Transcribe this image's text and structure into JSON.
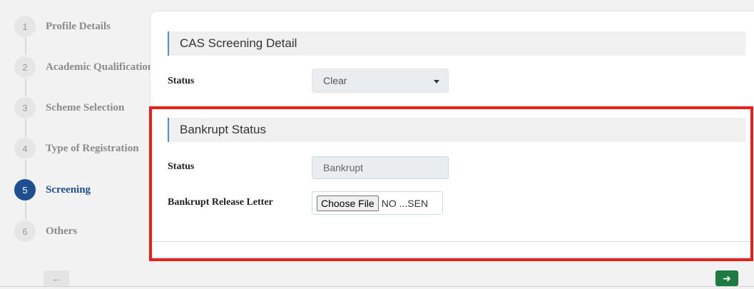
{
  "stepper": {
    "steps": [
      {
        "number": "1",
        "label": "Profile Details"
      },
      {
        "number": "2",
        "label": "Academic Qualifications"
      },
      {
        "number": "3",
        "label": "Scheme Selection"
      },
      {
        "number": "4",
        "label": "Type of Registration"
      },
      {
        "number": "5",
        "label": "Screening"
      },
      {
        "number": "6",
        "label": "Others"
      }
    ],
    "active_step": "5"
  },
  "cas_section": {
    "title": "CAS Screening Detail",
    "status_label": "Status",
    "status_value": "Clear"
  },
  "bankrupt_section": {
    "title": "Bankrupt Status",
    "status_label": "Status",
    "status_value": "Bankrupt",
    "letter_label": "Bankrupt Release Letter",
    "choose_file_label": "Choose File",
    "file_text": "NO ...SEN"
  },
  "navigation": {
    "prev_icon": "arrow-left-icon",
    "next_icon": "arrow-right-icon"
  },
  "colors": {
    "active_step": "#1e4f8f",
    "section_accent": "#4a90d9",
    "highlight": "#e8201c",
    "next_button": "#1e7a43"
  }
}
